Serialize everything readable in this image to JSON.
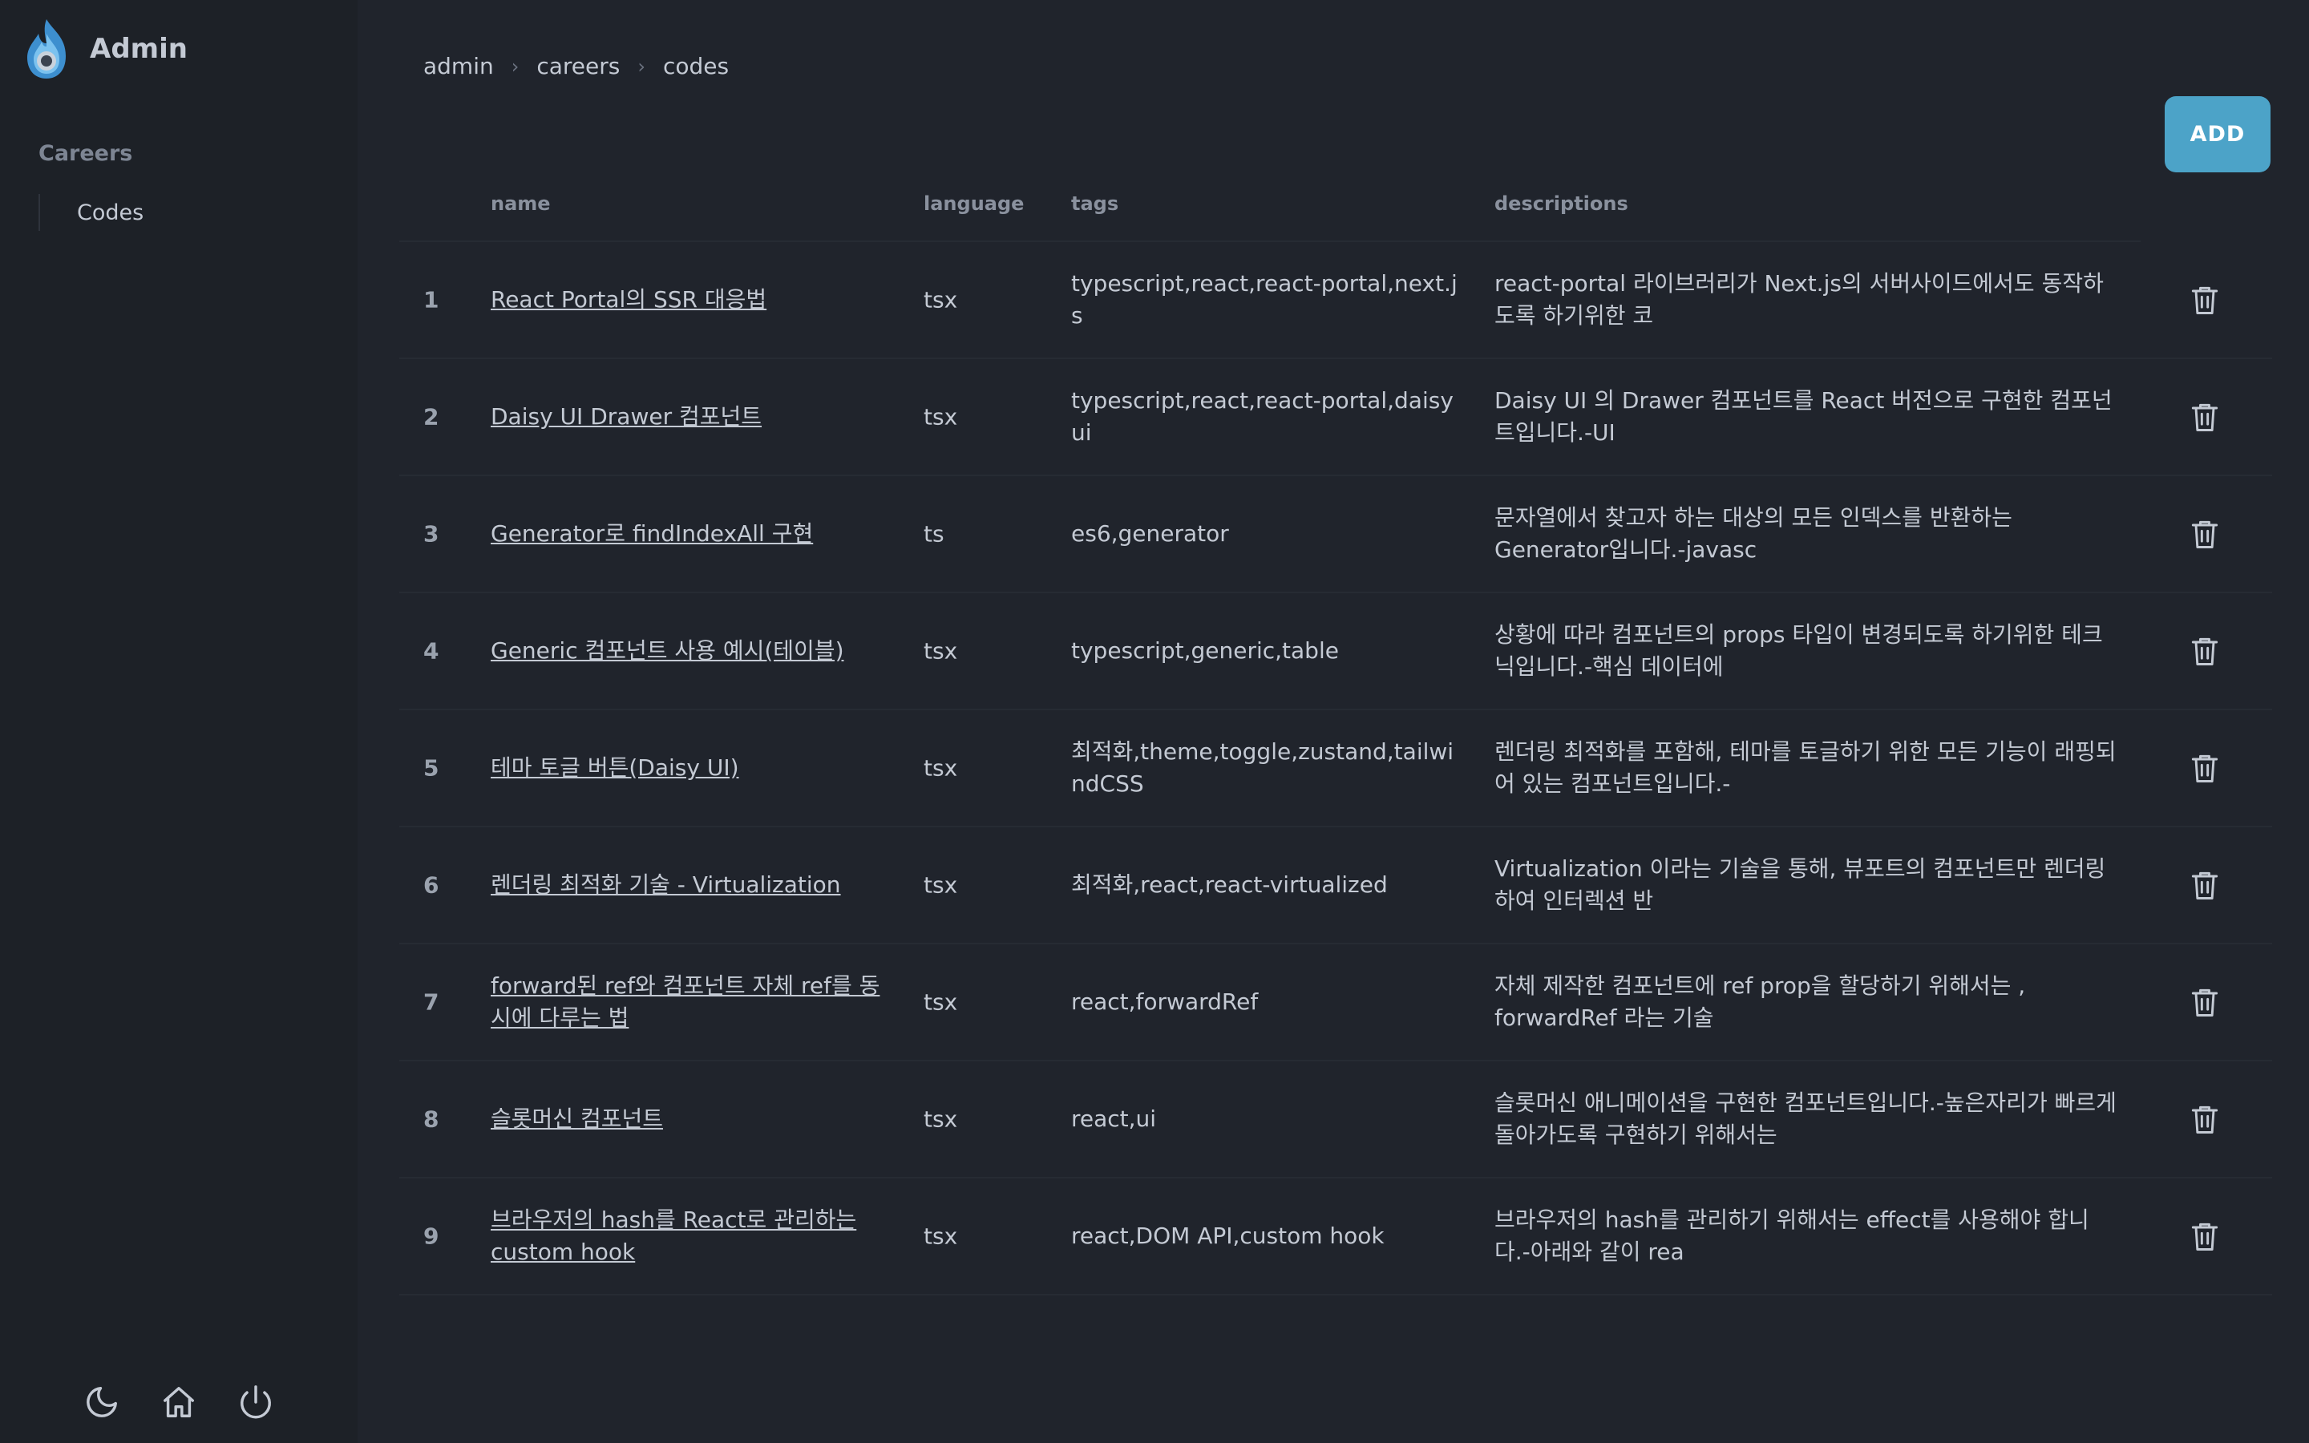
{
  "sidebar": {
    "brand_title": "Admin",
    "section_title": "Careers",
    "items": [
      {
        "label": "Codes"
      }
    ],
    "footer_icons": [
      "moon-icon",
      "home-icon",
      "power-icon"
    ]
  },
  "breadcrumb": [
    "admin",
    "careers",
    "codes"
  ],
  "add_button": "ADD",
  "table": {
    "headers": {
      "name": "name",
      "language": "language",
      "tags": "tags",
      "descriptions": "descriptions"
    },
    "rows": [
      {
        "num": "1",
        "name": "React Portal의 SSR 대응법",
        "language": "tsx",
        "tags": "typescript,react,react-portal,next.js",
        "description": "react-portal 라이브러리가 Next.js의 서버사이드에서도 동작하도록 하기위한 코"
      },
      {
        "num": "2",
        "name": "Daisy UI Drawer 컴포넌트",
        "language": "tsx",
        "tags": "typescript,react,react-portal,daisy ui",
        "description": "Daisy UI 의 Drawer 컴포넌트를 React 버전으로 구현한 컴포넌트입니다.-UI"
      },
      {
        "num": "3",
        "name": "Generator로 findIndexAll 구현",
        "language": "ts",
        "tags": "es6,generator",
        "description": "문자열에서 찾고자 하는 대상의 모든 인덱스를 반환하는 Generator입니다.-javasc"
      },
      {
        "num": "4",
        "name": "Generic 컴포넌트 사용 예시(테이블)",
        "language": "tsx",
        "tags": "typescript,generic,table",
        "description": "상황에 따라 컴포넌트의 props 타입이 변경되도록 하기위한 테크닉입니다.-핵심 데이터에"
      },
      {
        "num": "5",
        "name": "테마 토글 버튼(Daisy UI)",
        "language": "tsx",
        "tags": "최적화,theme,toggle,zustand,tailwindCSS",
        "description": "렌더링 최적화를 포함해, 테마를 토글하기 위한 모든 기능이 래핑되어 있는 컴포넌트입니다.-"
      },
      {
        "num": "6",
        "name": "렌더링 최적화 기술 - Virtualization",
        "language": "tsx",
        "tags": "최적화,react,react-virtualized",
        "description": "Virtualization 이라는 기술을 통해, 뷰포트의 컴포넌트만 렌더링하여 인터렉션 반"
      },
      {
        "num": "7",
        "name": "forward된 ref와 컴포넌트 자체 ref를 동시에 다루는 법",
        "language": "tsx",
        "tags": "react,forwardRef",
        "description": "자체 제작한 컴포넌트에 ref prop을 할당하기 위해서는 , forwardRef 라는 기술"
      },
      {
        "num": "8",
        "name": "슬롯머신 컴포넌트",
        "language": "tsx",
        "tags": "react,ui",
        "description": "슬롯머신 애니메이션을 구현한 컴포넌트입니다.-높은자리가 빠르게 돌아가도록 구현하기 위해서는"
      },
      {
        "num": "9",
        "name": "브라우저의 hash를 React로 관리하는 custom hook",
        "language": "tsx",
        "tags": "react,DOM API,custom hook",
        "description": "브라우저의 hash를 관리하기 위해서는 effect를 사용해야 합니다.-아래와 같이 rea"
      }
    ]
  }
}
